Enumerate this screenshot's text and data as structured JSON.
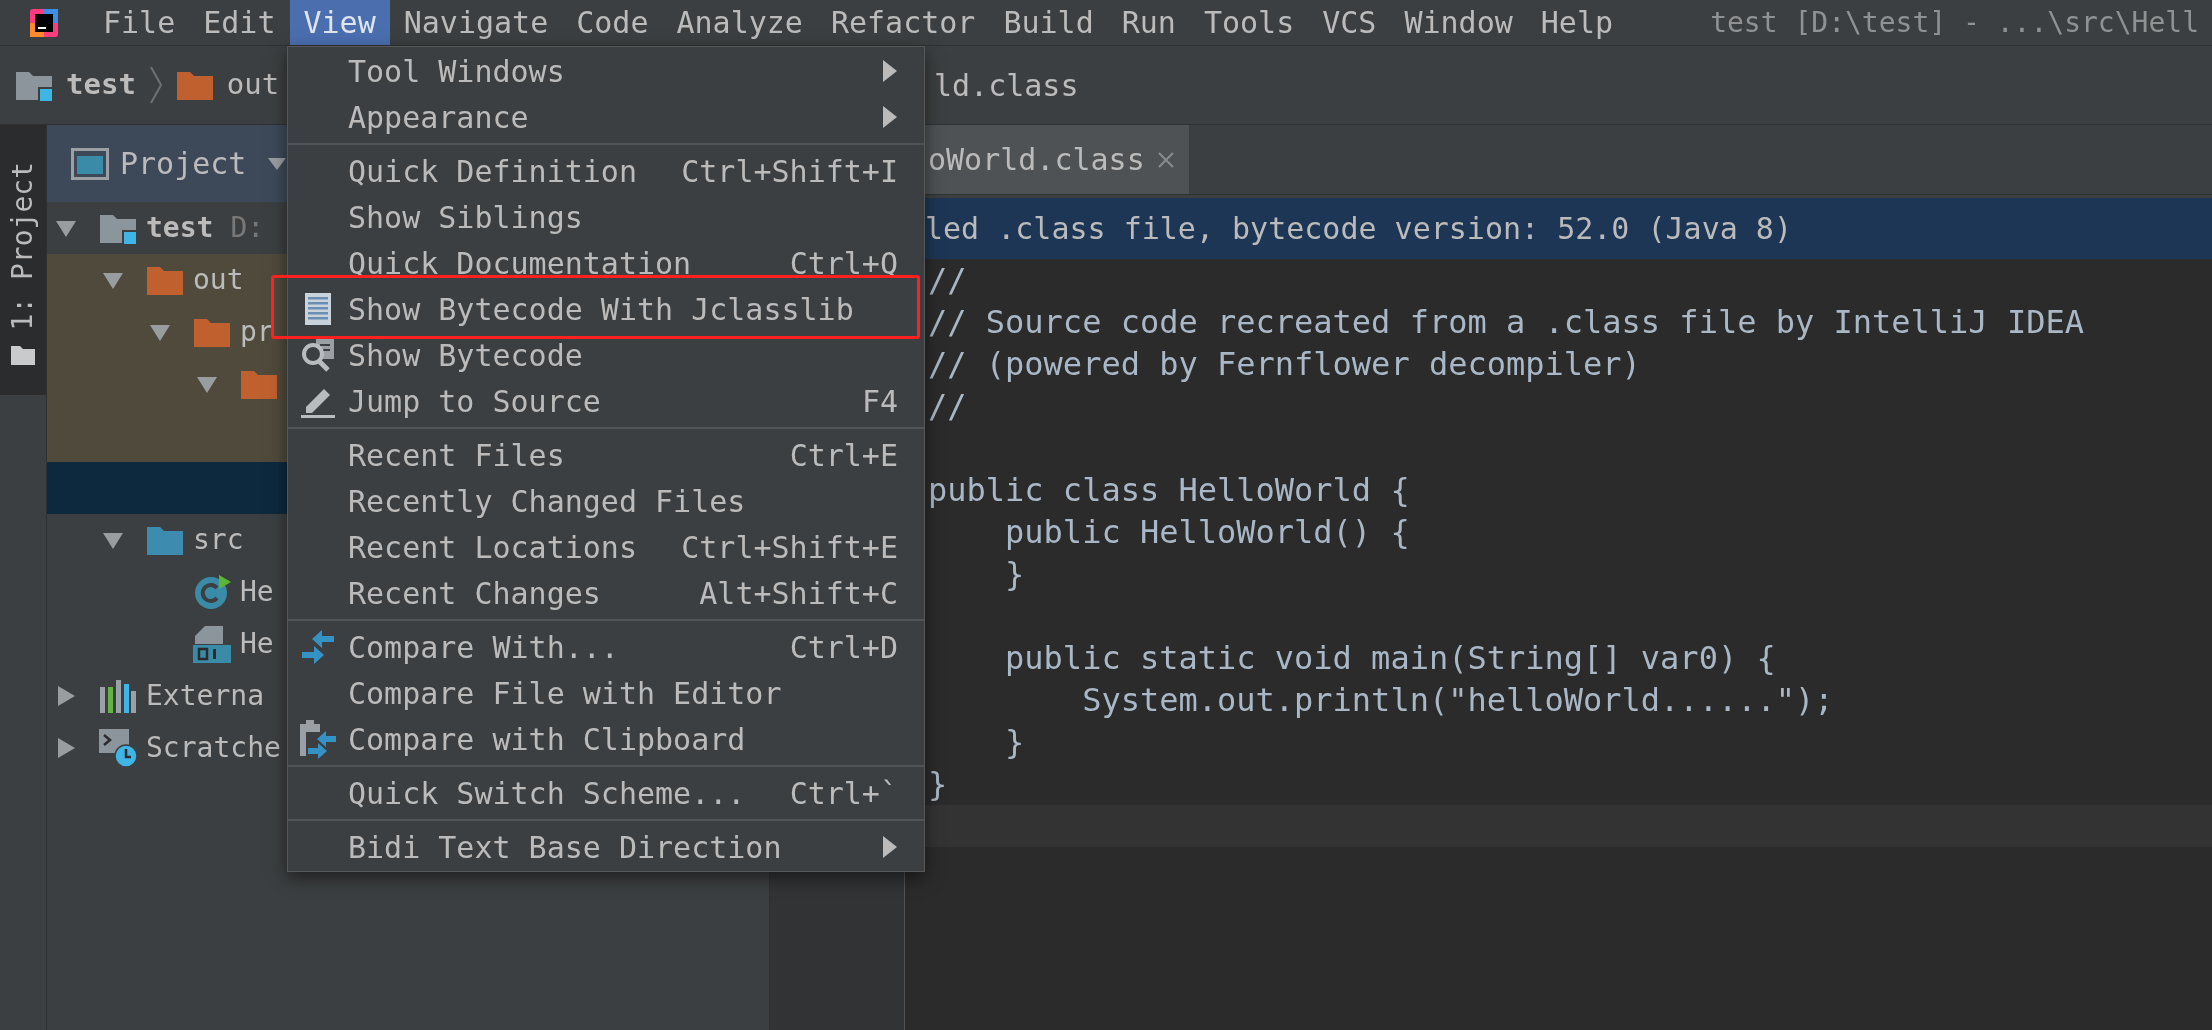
{
  "menubar": {
    "items": [
      {
        "label": "File",
        "selected": false
      },
      {
        "label": "Edit",
        "selected": false
      },
      {
        "label": "View",
        "selected": true
      },
      {
        "label": "Navigate",
        "selected": false
      },
      {
        "label": "Code",
        "selected": false
      },
      {
        "label": "Analyze",
        "selected": false
      },
      {
        "label": "Refactor",
        "selected": false
      },
      {
        "label": "Build",
        "selected": false
      },
      {
        "label": "Run",
        "selected": false
      },
      {
        "label": "Tools",
        "selected": false
      },
      {
        "label": "VCS",
        "selected": false
      },
      {
        "label": "Window",
        "selected": false
      },
      {
        "label": "Help",
        "selected": false
      }
    ]
  },
  "window_title": "test [D:\\test] - ...\\src\\Hell",
  "breadcrumbs": {
    "items": [
      {
        "label": "test",
        "kind": "module"
      },
      {
        "label": "out",
        "kind": "excluded_folder"
      }
    ],
    "tail": "ld.class"
  },
  "tool_strip": {
    "tabs": [
      {
        "label": "1: Project",
        "selected": true
      }
    ]
  },
  "project_panel": {
    "title": "Project",
    "tree": [
      {
        "label": "test",
        "hint": "D:",
        "kind": "module",
        "expanded": true,
        "excluded": false,
        "selected": false,
        "children": [
          {
            "label": "out",
            "kind": "folder",
            "expanded": true,
            "excluded": true,
            "selected": false,
            "children": [
              {
                "label": "pr",
                "kind": "folder",
                "expanded": true,
                "excluded": true,
                "selected": false,
                "children": [
                  {
                    "kind": "folder",
                    "expanded": true,
                    "excluded": true,
                    "selected": false,
                    "children": [
                      {
                        "excluded": true,
                        "selected": false
                      },
                      {
                        "selected": true
                      }
                    ]
                  }
                ]
              }
            ]
          },
          {
            "label": "src",
            "kind": "source_folder",
            "expanded": true,
            "excluded": false,
            "selected": false,
            "children": [
              {
                "label": "He",
                "kind": "class",
                "excluded": false,
                "selected": false
              },
              {
                "label": "He",
                "kind": "class_file",
                "excluded": false,
                "selected": false
              }
            ]
          }
        ]
      },
      {
        "label": "Externa",
        "kind": "libraries",
        "expanded": false,
        "excluded": false,
        "selected": false
      },
      {
        "label": "Scratche",
        "kind": "scratches",
        "expanded": false,
        "excluded": false,
        "selected": false
      }
    ]
  },
  "editor": {
    "tabs": [
      {
        "label": "oWorld.class",
        "selected": true
      }
    ],
    "banner": "led .class file, bytecode version: 52.0 (Java 8)",
    "lines": [
      {
        "kind": "code",
        "text": "//"
      },
      {
        "kind": "code",
        "text": "// Source code recreated from a .class file by IntelliJ IDEA"
      },
      {
        "kind": "code",
        "text": "// (powered by Fernflower decompiler)"
      },
      {
        "kind": "code",
        "text": "//"
      },
      {
        "kind": "blank"
      },
      {
        "kind": "code",
        "text": "public class HelloWorld {"
      },
      {
        "kind": "code",
        "text": "    public HelloWorld() {"
      },
      {
        "kind": "code",
        "text": "    }"
      },
      {
        "kind": "blank"
      },
      {
        "kind": "code",
        "text": "    public static void main(String[] var0) {"
      },
      {
        "kind": "code",
        "text": "        System.out.println(\"helloWorld......\");"
      },
      {
        "kind": "code",
        "text": "    }"
      },
      {
        "kind": "code",
        "text": "}"
      },
      {
        "kind": "caret_line"
      }
    ]
  },
  "menu": {
    "groups": [
      [
        {
          "label": "Tool Windows",
          "kind": "submenu",
          "boxed": false
        },
        {
          "label": "Appearance",
          "kind": "submenu",
          "boxed": false
        }
      ],
      [
        {
          "label": "Quick Definition",
          "shortcut": "Ctrl+Shift+I",
          "kind": "action",
          "boxed": false
        },
        {
          "label": "Show Siblings",
          "kind": "action",
          "boxed": false
        },
        {
          "label": "Quick Documentation",
          "shortcut": "Ctrl+Q",
          "kind": "action",
          "boxed": false
        },
        {
          "label": "Show Bytecode With Jclasslib",
          "kind": "bytecode",
          "boxed": true
        },
        {
          "label": "Show Bytecode",
          "kind": "magnifier",
          "boxed": false
        },
        {
          "label": "Jump to Source",
          "shortcut": "F4",
          "kind": "pencil",
          "boxed": false
        }
      ],
      [
        {
          "label": "Recent Files",
          "shortcut": "Ctrl+E",
          "kind": "action",
          "boxed": false
        },
        {
          "label": "Recently Changed Files",
          "kind": "action",
          "boxed": false
        },
        {
          "label": "Recent Locations",
          "shortcut": "Ctrl+Shift+E",
          "kind": "action",
          "boxed": false
        },
        {
          "label": "Recent Changes",
          "shortcut": "Alt+Shift+C",
          "kind": "action",
          "boxed": false
        }
      ],
      [
        {
          "label": "Compare With...",
          "shortcut": "Ctrl+D",
          "kind": "compare",
          "boxed": false
        },
        {
          "label": "Compare File with Editor",
          "kind": "action",
          "boxed": false
        },
        {
          "label": "Compare with Clipboard",
          "kind": "clipboard",
          "boxed": false
        }
      ],
      [
        {
          "label": "Quick Switch Scheme...",
          "shortcut": "Ctrl+`",
          "kind": "action",
          "boxed": false
        }
      ],
      [
        {
          "label": "Bidi Text Base Direction",
          "kind": "submenu",
          "boxed": false
        }
      ]
    ]
  }
}
